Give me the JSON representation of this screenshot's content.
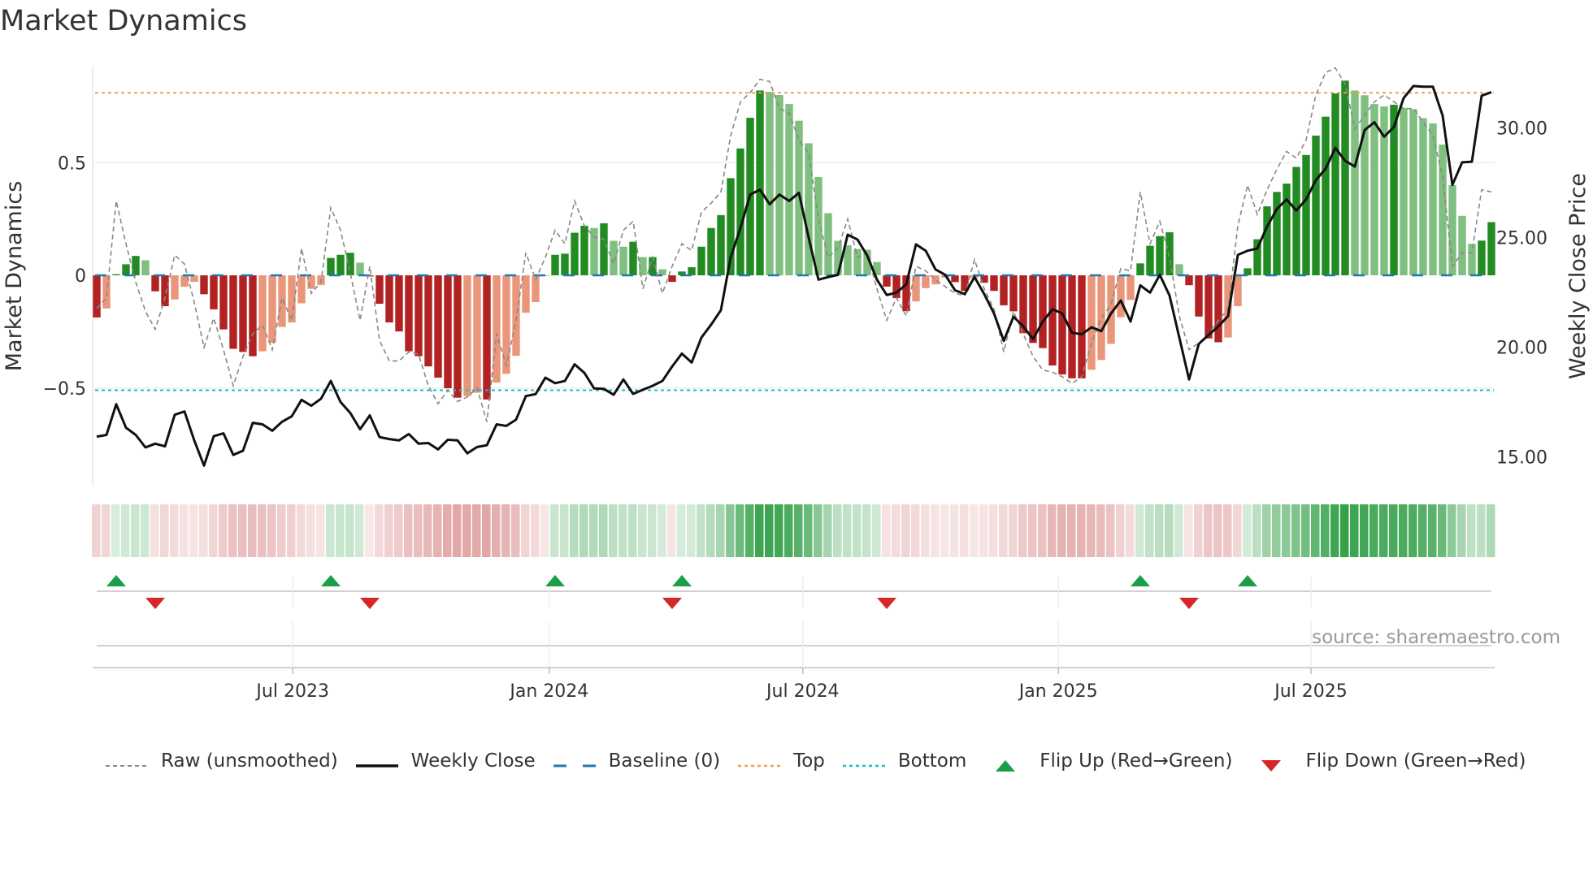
{
  "title": "Market Dynamics",
  "source": "source: sharemaestro.com",
  "colors": {
    "pos_strong": "#228b22",
    "pos_weak": "#7fbf7f",
    "neg_strong": "#b22222",
    "neg_weak": "#e9967a",
    "baseline": "#1f77b4",
    "top": "#f0a050",
    "bottom": "#17becf",
    "raw": "#888888",
    "close": "#111111",
    "flip_up": "#1a9e4a",
    "flip_down": "#d62728"
  },
  "chart_data": {
    "type": "bar+line",
    "title": "Market Dynamics",
    "ylabel": "Market Dynamics",
    "y2label": "Weekly Close Price",
    "ylim": [
      -0.94,
      0.95
    ],
    "y2lim": [
      13.6,
      32.7
    ],
    "yticks": [
      {
        "value": 0.5,
        "label": "0.5"
      },
      {
        "value": 0,
        "label": "0"
      },
      {
        "value": -0.5,
        "label": "−0.5"
      }
    ],
    "y2ticks": [
      {
        "value": 30,
        "label": "30.00"
      },
      {
        "value": 25,
        "label": "25.00"
      },
      {
        "value": 20,
        "label": "20.00"
      },
      {
        "value": 15,
        "label": "15.00"
      }
    ],
    "xticks": [
      {
        "week_index": 20.1,
        "label": "Jul 2023"
      },
      {
        "week_index": 46.4,
        "label": "Jan 2024"
      },
      {
        "week_index": 72.4,
        "label": "Jul 2024"
      },
      {
        "week_index": 98.6,
        "label": "Jan 2025"
      },
      {
        "week_index": 124.5,
        "label": "Jul 2025"
      }
    ],
    "top_level": 0.81,
    "bottom_level": -0.51,
    "baseline": 0,
    "smoothed": [
      -0.187,
      -0.147,
      0.005,
      0.049,
      0.086,
      0.067,
      -0.071,
      -0.137,
      -0.107,
      -0.051,
      -0.029,
      -0.084,
      -0.151,
      -0.24,
      -0.326,
      -0.34,
      -0.359,
      -0.337,
      -0.299,
      -0.229,
      -0.209,
      -0.124,
      -0.06,
      -0.043,
      0.077,
      0.091,
      0.1,
      0.056,
      -0.005,
      -0.126,
      -0.209,
      -0.249,
      -0.337,
      -0.359,
      -0.404,
      -0.454,
      -0.501,
      -0.543,
      -0.536,
      -0.521,
      -0.551,
      -0.476,
      -0.437,
      -0.357,
      -0.166,
      -0.119,
      -0.003,
      0.091,
      0.096,
      0.189,
      0.22,
      0.21,
      0.231,
      0.153,
      0.127,
      0.149,
      0.081,
      0.081,
      0.027,
      -0.029,
      0.017,
      0.036,
      0.127,
      0.21,
      0.267,
      0.431,
      0.563,
      0.699,
      0.82,
      0.814,
      0.8,
      0.76,
      0.686,
      0.586,
      0.436,
      0.276,
      0.153,
      0.133,
      0.117,
      0.113,
      0.059,
      -0.05,
      -0.101,
      -0.159,
      -0.116,
      -0.057,
      -0.04,
      -0.01,
      -0.03,
      -0.069,
      -0.012,
      -0.033,
      -0.069,
      -0.133,
      -0.16,
      -0.257,
      -0.3,
      -0.323,
      -0.4,
      -0.44,
      -0.457,
      -0.457,
      -0.419,
      -0.376,
      -0.304,
      -0.186,
      -0.109,
      0.053,
      0.131,
      0.174,
      0.191,
      0.049,
      -0.044,
      -0.183,
      -0.28,
      -0.297,
      -0.276,
      -0.137,
      0.031,
      0.16,
      0.306,
      0.37,
      0.407,
      0.481,
      0.534,
      0.62,
      0.704,
      0.807,
      0.864,
      0.82,
      0.799,
      0.76,
      0.749,
      0.757,
      0.743,
      0.737,
      0.697,
      0.674,
      0.58,
      0.4,
      0.264,
      0.14,
      0.154,
      0.236
    ],
    "raw": [
      -0.147,
      -0.1,
      0.33,
      0.14,
      -0.03,
      -0.16,
      -0.24,
      -0.1,
      0.09,
      0.05,
      -0.12,
      -0.32,
      -0.19,
      -0.33,
      -0.49,
      -0.36,
      -0.26,
      -0.22,
      -0.33,
      -0.1,
      -0.2,
      0.12,
      -0.08,
      -0.03,
      0.3,
      0.2,
      0.01,
      -0.2,
      0.04,
      -0.29,
      -0.38,
      -0.38,
      -0.34,
      -0.35,
      -0.49,
      -0.57,
      -0.51,
      -0.56,
      -0.54,
      -0.5,
      -0.65,
      -0.26,
      -0.4,
      -0.2,
      0.1,
      -0.02,
      0.08,
      0.2,
      0.14,
      0.33,
      0.22,
      0.17,
      0.16,
      0.05,
      0.2,
      0.24,
      -0.06,
      0.08,
      -0.08,
      0.04,
      0.14,
      0.11,
      0.28,
      0.32,
      0.37,
      0.62,
      0.77,
      0.81,
      0.87,
      0.86,
      0.74,
      0.72,
      0.6,
      0.54,
      0.25,
      0.08,
      0.12,
      0.25,
      0.08,
      0.1,
      -0.06,
      -0.2,
      -0.1,
      -0.18,
      0.04,
      0.02,
      -0.02,
      -0.05,
      -0.08,
      -0.09,
      0.07,
      -0.06,
      -0.15,
      -0.34,
      -0.16,
      -0.26,
      -0.36,
      -0.42,
      -0.43,
      -0.45,
      -0.48,
      -0.45,
      -0.3,
      -0.19,
      -0.13,
      0.03,
      0.02,
      0.37,
      0.14,
      0.24,
      0.08,
      -0.18,
      -0.33,
      -0.3,
      -0.26,
      -0.2,
      -0.15,
      0.22,
      0.4,
      0.27,
      0.38,
      0.47,
      0.55,
      0.52,
      0.6,
      0.8,
      0.9,
      0.92,
      0.85,
      0.65,
      0.71,
      0.77,
      0.8,
      0.77,
      0.74,
      0.74,
      0.68,
      0.62,
      0.44,
      0.04,
      0.1,
      0.1,
      0.38,
      0.37
    ],
    "close": [
      15.92,
      16.0,
      17.4,
      16.33,
      16.0,
      15.43,
      15.6,
      15.48,
      16.92,
      17.07,
      15.75,
      14.6,
      15.94,
      16.07,
      15.09,
      15.28,
      16.55,
      16.48,
      16.19,
      16.6,
      16.85,
      17.6,
      17.33,
      17.65,
      18.46,
      17.5,
      17.0,
      16.26,
      16.89,
      15.9,
      15.81,
      15.75,
      16.04,
      15.6,
      15.63,
      15.34,
      15.78,
      15.75,
      15.16,
      15.45,
      15.53,
      16.48,
      16.41,
      16.7,
      17.77,
      17.86,
      18.61,
      18.36,
      18.46,
      19.22,
      18.83,
      18.12,
      18.1,
      17.83,
      18.53,
      17.87,
      18.06,
      18.24,
      18.46,
      19.12,
      19.71,
      19.3,
      20.44,
      21.03,
      21.69,
      24.1,
      25.43,
      26.96,
      27.18,
      26.52,
      26.96,
      26.67,
      27.04,
      24.99,
      23.08,
      23.2,
      23.3,
      25.13,
      24.91,
      24.18,
      23.08,
      22.38,
      22.49,
      22.86,
      24.69,
      24.4,
      23.55,
      23.3,
      22.6,
      22.42,
      23.2,
      22.42,
      21.54,
      20.29,
      21.39,
      20.95,
      20.37,
      21.17,
      21.73,
      21.54,
      20.66,
      20.59,
      20.91,
      20.73,
      21.54,
      22.13,
      21.17,
      22.82,
      22.49,
      23.3,
      22.35,
      20.44,
      18.53,
      20.15,
      20.56,
      20.95,
      21.42,
      24.21,
      24.4,
      24.5,
      25.5,
      26.3,
      26.74,
      26.23,
      26.74,
      27.62,
      28.14,
      29.09,
      28.5,
      28.24,
      29.9,
      30.26,
      29.6,
      30.04,
      31.36,
      31.91,
      31.88,
      31.88,
      30.56,
      27.4,
      28.43,
      28.46,
      31.47,
      31.63
    ],
    "legend": [
      {
        "key": "raw",
        "label": "Raw (unsmoothed)"
      },
      {
        "key": "close",
        "label": "Weekly Close"
      },
      {
        "key": "baseline",
        "label": "Baseline (0)"
      },
      {
        "key": "top",
        "label": "Top"
      },
      {
        "key": "bottom",
        "label": "Bottom"
      },
      {
        "key": "flip_up",
        "label": "Flip Up (Red→Green)"
      },
      {
        "key": "flip_down",
        "label": "Flip Down (Green→Red)"
      }
    ],
    "legend_position": "bottom"
  }
}
